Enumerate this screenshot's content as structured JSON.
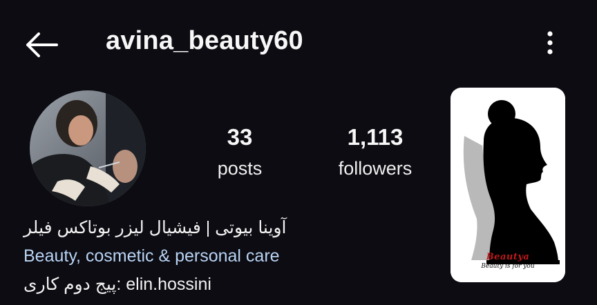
{
  "header": {
    "username": "avina_beauty60"
  },
  "stats": [
    {
      "count": "33",
      "label": "posts"
    },
    {
      "count": "1,113",
      "label": "followers"
    }
  ],
  "bio": {
    "line1": "آوینا بیوتی | فیشیال لیزر بوتاکس فیلر",
    "category": "Beauty, cosmetic & personal care",
    "line3": "پیج دوم کاری: elin.hossini"
  },
  "highlight": {
    "brand": "Beautya",
    "tagline": "Beauty is for you"
  },
  "colors": {
    "background": "#0c0c12",
    "category_text": "#b9d4f5",
    "brand_red": "#c0181b"
  }
}
